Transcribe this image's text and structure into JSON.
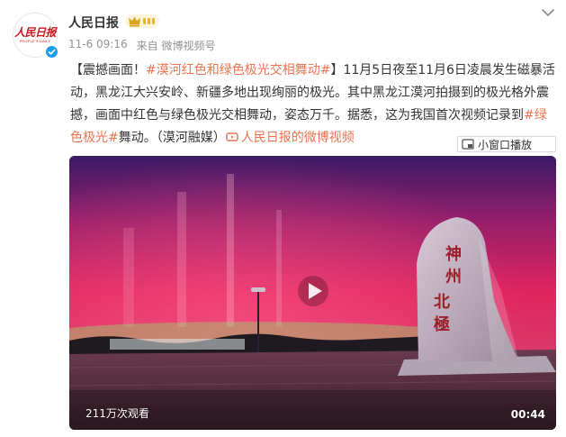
{
  "post": {
    "author": "人民日报",
    "avatar_text_cn": "人民日报",
    "avatar_text_en": "PEOPLE'S DAILY",
    "time": "11-6 09:16",
    "source": "来自 微博视频号"
  },
  "text": {
    "open_bracket": "【",
    "lead": "震撼画面！",
    "topic1": "#漠河红色和绿色极光交相舞动#",
    "close_bracket": "】",
    "body1": "11月5日夜至11月6日凌晨发生磁暴活动，黑龙江大兴安岭、新疆多地出现绚丽的极光。其中黑龙江漠河拍摄到的极光格外震撼，画面中红色与绿色极光交相舞动，姿态万千。据悉，这为我国首次视频记录到",
    "topic2": "#绿色极光#",
    "body2": "舞动。（漠河融媒）",
    "link": "人民日报的微博视频"
  },
  "mini_window": {
    "label": "小窗口播放"
  },
  "video": {
    "views": "211万次观看",
    "duration": "00:44",
    "monument_text": "神州北極"
  },
  "colors": {
    "link": "#eb7350",
    "aurora_red": "#e0245e",
    "aurora_green": "#79c66a"
  }
}
